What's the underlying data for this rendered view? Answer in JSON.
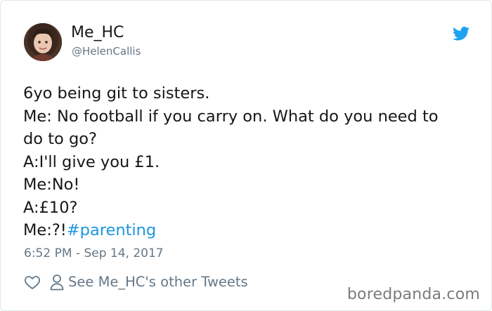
{
  "author": {
    "display_name": "Me_HC",
    "handle": "@HelenCallis"
  },
  "tweet": {
    "lines": [
      "6yo being git to sisters.",
      "Me: No football if you carry on. What do you need to",
      "do to go?",
      "A:I'll give you £1.",
      "Me:No!",
      "A:£10?"
    ],
    "last_line_prefix": "Me:?!",
    "hashtag": "#parenting",
    "timestamp": "6:52 PM - Sep 14, 2017"
  },
  "actions": {
    "other_tweets_label": "See Me_HC's other Tweets"
  },
  "watermark": "boredpanda.com",
  "colors": {
    "text": "#14171a",
    "muted": "#657786",
    "link": "#1b95e0",
    "twitter_blue": "#1da1f2"
  },
  "icons": {
    "brand": "twitter-bird-icon",
    "like": "heart-icon",
    "profile": "person-icon"
  }
}
